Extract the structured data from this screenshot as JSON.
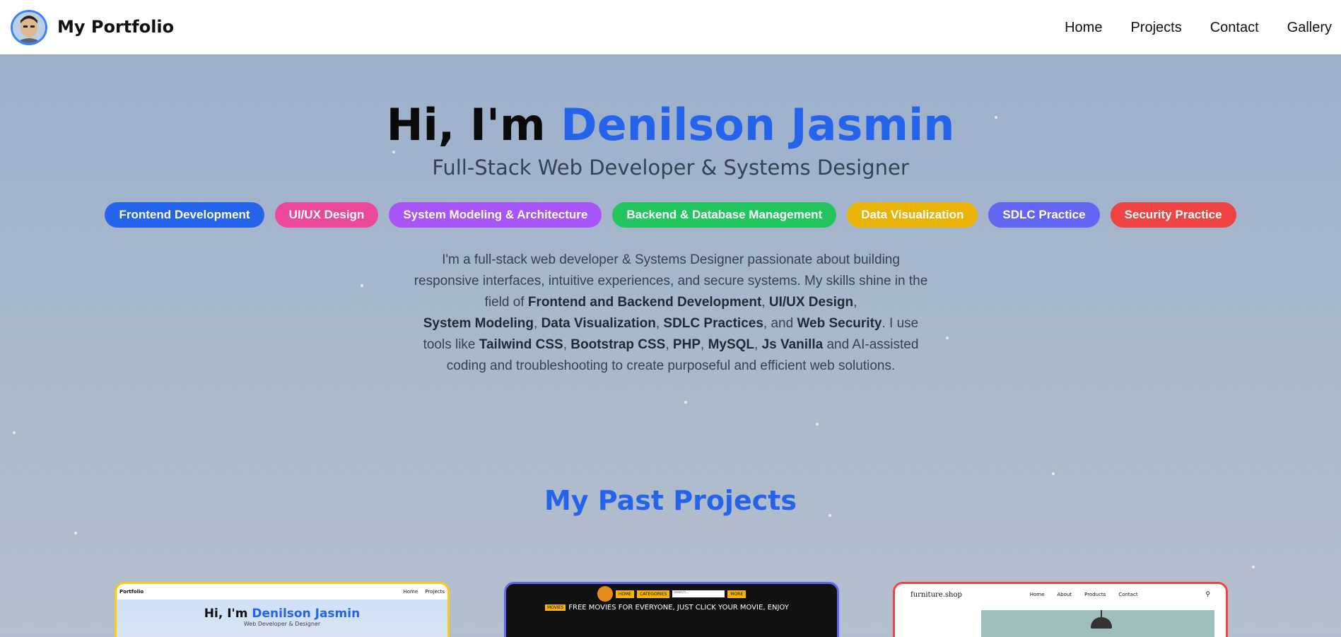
{
  "header": {
    "brand": "My Portfolio",
    "nav": [
      "Home",
      "Projects",
      "Contact",
      "Gallery"
    ]
  },
  "hero": {
    "greeting": "Hi, I'm",
    "name": "Denilson Jasmin",
    "subtitle": "Full-Stack Web Developer & Systems Designer",
    "tags": [
      {
        "label": "Frontend Development",
        "color": "#2563eb"
      },
      {
        "label": "UI/UX Design",
        "color": "#ec4899"
      },
      {
        "label": "System Modeling & Architecture",
        "color": "#a855f7"
      },
      {
        "label": "Backend & Database Management",
        "color": "#22c55e"
      },
      {
        "label": "Data Visualization",
        "color": "#eab308"
      },
      {
        "label": "SDLC Practice",
        "color": "#6366f1"
      },
      {
        "label": "Security Practice",
        "color": "#ef4444"
      }
    ],
    "intro": {
      "p1": "I'm a full-stack web developer & Systems Designer passionate about building responsive interfaces, intuitive experiences, and secure systems. My skills shine in the field of ",
      "b1": "Frontend and Backend Development",
      "p2": ", ",
      "b2": "UI/UX Design",
      "p3": ", ",
      "b3": "System Modeling",
      "p4": ", ",
      "b4": "Data Visualization",
      "p5": ", ",
      "b5": "SDLC Practices",
      "p6": ", and ",
      "b6": "Web Security",
      "p7": ". I use tools like ",
      "b7": "Tailwind CSS",
      "p8": ", ",
      "b8": "Bootstrap CSS",
      "p9": ", ",
      "b9": "PHP",
      "p10": ", ",
      "b10": "MySQL",
      "p11": ", ",
      "b11": "Js Vanilla",
      "p12": " and AI-assisted coding and troubleshooting to create purposeful and efficient web solutions."
    }
  },
  "projects": {
    "title": "My Past Projects",
    "card1": {
      "nav_brand": "Portfolio",
      "nav_links": [
        "Home",
        "Projects"
      ],
      "greeting": "Hi, I'm",
      "name": "Denilson Jasmin",
      "subtitle": "Web Developer & Designer"
    },
    "card2": {
      "buttons": [
        "HOME",
        "CATEGORIES",
        "MORE"
      ],
      "search_placeholder": "search...",
      "badge": "MOVIES",
      "marquee": "FREE MOVIES FOR EVERYONE, JUST CLICK YOUR MOVIE, ENJOY"
    },
    "card3": {
      "brand": "furniture.shop",
      "links": [
        "Home",
        "About",
        "Products",
        "Contact"
      ]
    }
  },
  "colors": {
    "accent": "#2563eb",
    "card1_border": "#facc15",
    "card2_border": "#6366f1",
    "card3_border": "#ef4444"
  }
}
